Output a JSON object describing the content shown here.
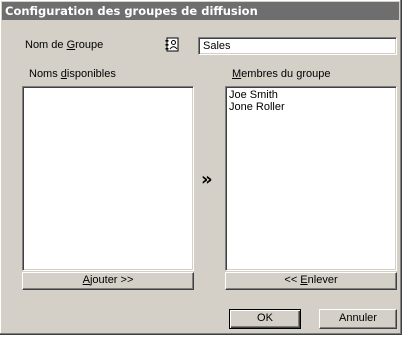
{
  "dialog": {
    "title": "Configuration des groupes de diffusion"
  },
  "group_name": {
    "label_pre": "Nom de ",
    "label_ul": "G",
    "label_post": "roupe",
    "value": "Sales",
    "icon": "address-book-icon"
  },
  "available": {
    "label_pre": "Noms ",
    "label_ul": "d",
    "label_post": "isponibles",
    "items": []
  },
  "members": {
    "label_pre": "",
    "label_ul": "M",
    "label_post": "embres du groupe",
    "items": [
      "Joe Smith",
      "Jone Roller"
    ]
  },
  "transfer_icon": "»",
  "buttons": {
    "add_ul": "A",
    "add_post": "jouter >>",
    "remove_pre": "<< ",
    "remove_ul": "E",
    "remove_post": "nlever",
    "ok": "OK",
    "cancel": "Annuler"
  },
  "colors": {
    "title_bg": "#6e6e6e",
    "face": "#d4d0c8"
  }
}
